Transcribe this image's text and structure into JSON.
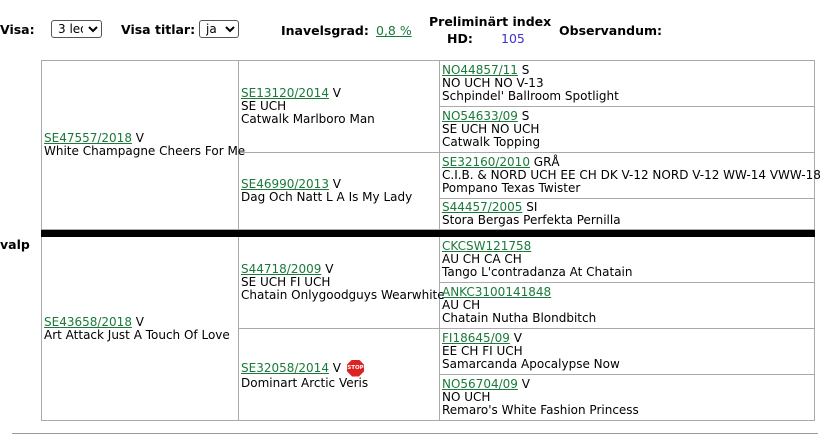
{
  "header": {
    "visa_label": "Visa:",
    "visa_value": "3 led",
    "visa_titlar_label": "Visa titlar:",
    "visa_titlar_value": "ja",
    "inavelsgrad_label": "Inavelsgrad:",
    "inavelsgrad_value": "0,8 %",
    "prelim_label": "Preliminärt index",
    "hd_label": "HD:",
    "hd_value": "105",
    "observandum_label": "Observandum:"
  },
  "side_label": "valp",
  "pedigree": {
    "sire": {
      "reg": "SE47557/2018",
      "sex": "V",
      "titles": "",
      "name": "White Champagne Cheers For Me"
    },
    "sire_sire": {
      "reg": "SE13120/2014",
      "sex": "V",
      "titles": "SE UCH",
      "name": "Catwalk Marlboro Man"
    },
    "sire_sire_sire": {
      "reg": "NO44857/11",
      "sex": "S",
      "titles": "NO UCH NO V-13",
      "name": "Schpindel' Ballroom Spotlight"
    },
    "sire_sire_dam": {
      "reg": "NO54633/09",
      "sex": "S",
      "titles": "SE UCH NO UCH",
      "name": "Catwalk Topping"
    },
    "sire_dam": {
      "reg": "SE46990/2013",
      "sex": "V",
      "titles": "",
      "name": "Dag Och Natt L A Is My Lady"
    },
    "sire_dam_sire": {
      "reg": "SE32160/2010",
      "sex": "GRÅ",
      "titles": "C.I.B. & NORD UCH EE CH DK V-12 NORD V-12 WW-14 VWW-18",
      "name": "Pompano Texas Twister"
    },
    "sire_dam_dam": {
      "reg": "S44457/2005",
      "sex": "SI",
      "titles": "",
      "name": "Stora Bergas Perfekta Pernilla"
    },
    "dam": {
      "reg": "SE43658/2018",
      "sex": "V",
      "titles": "",
      "name": "Art Attack Just A Touch Of Love"
    },
    "dam_sire": {
      "reg": "S44718/2009",
      "sex": "V",
      "titles": "SE UCH FI UCH",
      "name": "Chatain Onlygoodguys Wearwhite"
    },
    "dam_sire_sire": {
      "reg": "CKCSW121758",
      "sex": "",
      "titles": "AU CH CA CH",
      "name": "Tango L'contradanza At Chatain"
    },
    "dam_sire_dam": {
      "reg": "ANKC3100141848",
      "sex": "",
      "titles": "AU CH",
      "name": "Chatain Nutha Blondbitch"
    },
    "dam_dam": {
      "reg": "SE32058/2014",
      "sex": "V",
      "titles": "",
      "name": "Dominart Arctic Veris",
      "stop_icon_text": "STOP"
    },
    "dam_dam_sire": {
      "reg": "FI18645/09",
      "sex": "V",
      "titles": "EE CH FI UCH",
      "name": "Samarcanda Apocalypse Now"
    },
    "dam_dam_dam": {
      "reg": "NO56704/09",
      "sex": "V",
      "titles": "NO UCH",
      "name": "Remaro's White Fashion Princess"
    }
  }
}
